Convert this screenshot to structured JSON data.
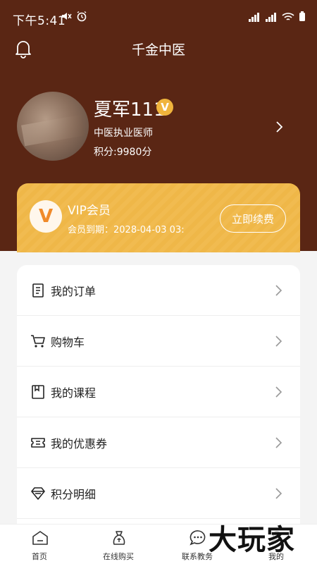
{
  "status_bar": {
    "time": "下午5:41",
    "battery_icon": "battery-icon"
  },
  "header": {
    "title": "千金中医"
  },
  "profile": {
    "name": "夏军111",
    "badge": "V",
    "role": "中医执业医师",
    "points": "积分:9980分"
  },
  "vip": {
    "logo": "V",
    "name": "VIP会员",
    "expiry": "会员到期：2028-04-03 03:",
    "renew_label": "立即续费"
  },
  "menu": {
    "items": [
      {
        "label": "我的订单",
        "icon": "order-icon"
      },
      {
        "label": "购物车",
        "icon": "cart-icon"
      },
      {
        "label": "我的课程",
        "icon": "course-icon"
      },
      {
        "label": "我的优惠券",
        "icon": "coupon-icon"
      },
      {
        "label": "积分明细",
        "icon": "points-icon"
      }
    ]
  },
  "tabbar": {
    "tabs": [
      {
        "label": "首页",
        "icon": "home-icon"
      },
      {
        "label": "在线购买",
        "icon": "bag-icon"
      },
      {
        "label": "联系教务",
        "icon": "chat-icon"
      },
      {
        "label": "我的",
        "icon": "profile-icon"
      }
    ]
  },
  "watermark": "大玩家",
  "colors": {
    "header_bg": "#5a2614",
    "vip_gold": "#efb748",
    "vip_logo": "#f08a2a"
  }
}
